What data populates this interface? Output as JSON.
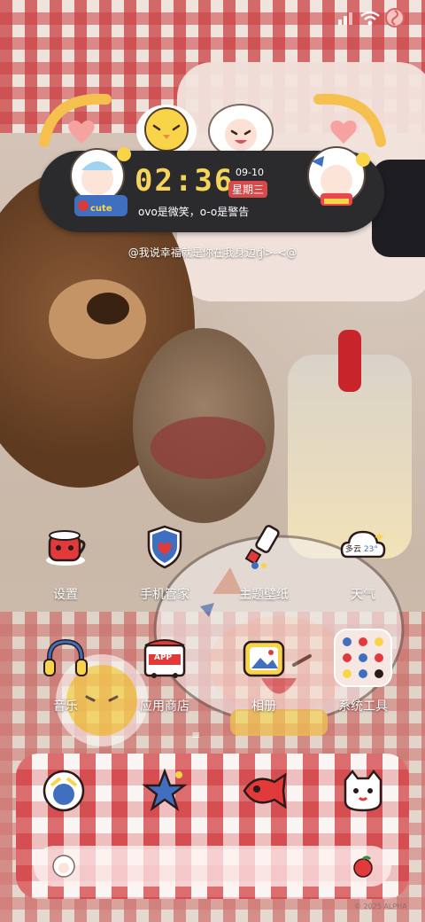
{
  "status_bar": {
    "icons": [
      "signal-icon",
      "wifi-icon",
      "lollipop-icon"
    ]
  },
  "clock_widget": {
    "time": "02:36",
    "date": "09-10",
    "weekday": "星期三",
    "caption": "ovo是微笑，o-o是警告",
    "sticker_text": "cute"
  },
  "slogan": "@我说幸福就是你在我身边ദ്ദി>-<@",
  "apps": [
    {
      "label": "设置",
      "icon": "teacup-icon"
    },
    {
      "label": "手机管家",
      "icon": "shield-icon"
    },
    {
      "label": "主题壁纸",
      "icon": "paintbrush-icon"
    },
    {
      "label": "天气",
      "icon": "cloud-icon"
    },
    {
      "label": "音乐",
      "icon": "headphones-icon"
    },
    {
      "label": "应用商店",
      "icon": "app-store-icon"
    },
    {
      "label": "相册",
      "icon": "photo-frame-icon"
    },
    {
      "label": "系统工具",
      "icon": "folder-icon"
    }
  ],
  "weather_badge": {
    "condition": "多云",
    "temp": "23°"
  },
  "app_store_badge": "APP",
  "page_indicator": "≡",
  "dock": {
    "icons": [
      "sheep-phone-icon",
      "star-messages-icon",
      "fish-camera-icon",
      "cat-browser-icon"
    ]
  },
  "search_bar": {
    "left_icon": "sheep-face-icon",
    "right_icon": "apple-icon"
  },
  "watermark": "© 2025 ALPHA",
  "colors": {
    "widget_bg": "#2b2b2e",
    "clock_yellow": "#f6d35b",
    "weekday_red": "#d84a4a",
    "gingham_red": "#c8282d"
  }
}
